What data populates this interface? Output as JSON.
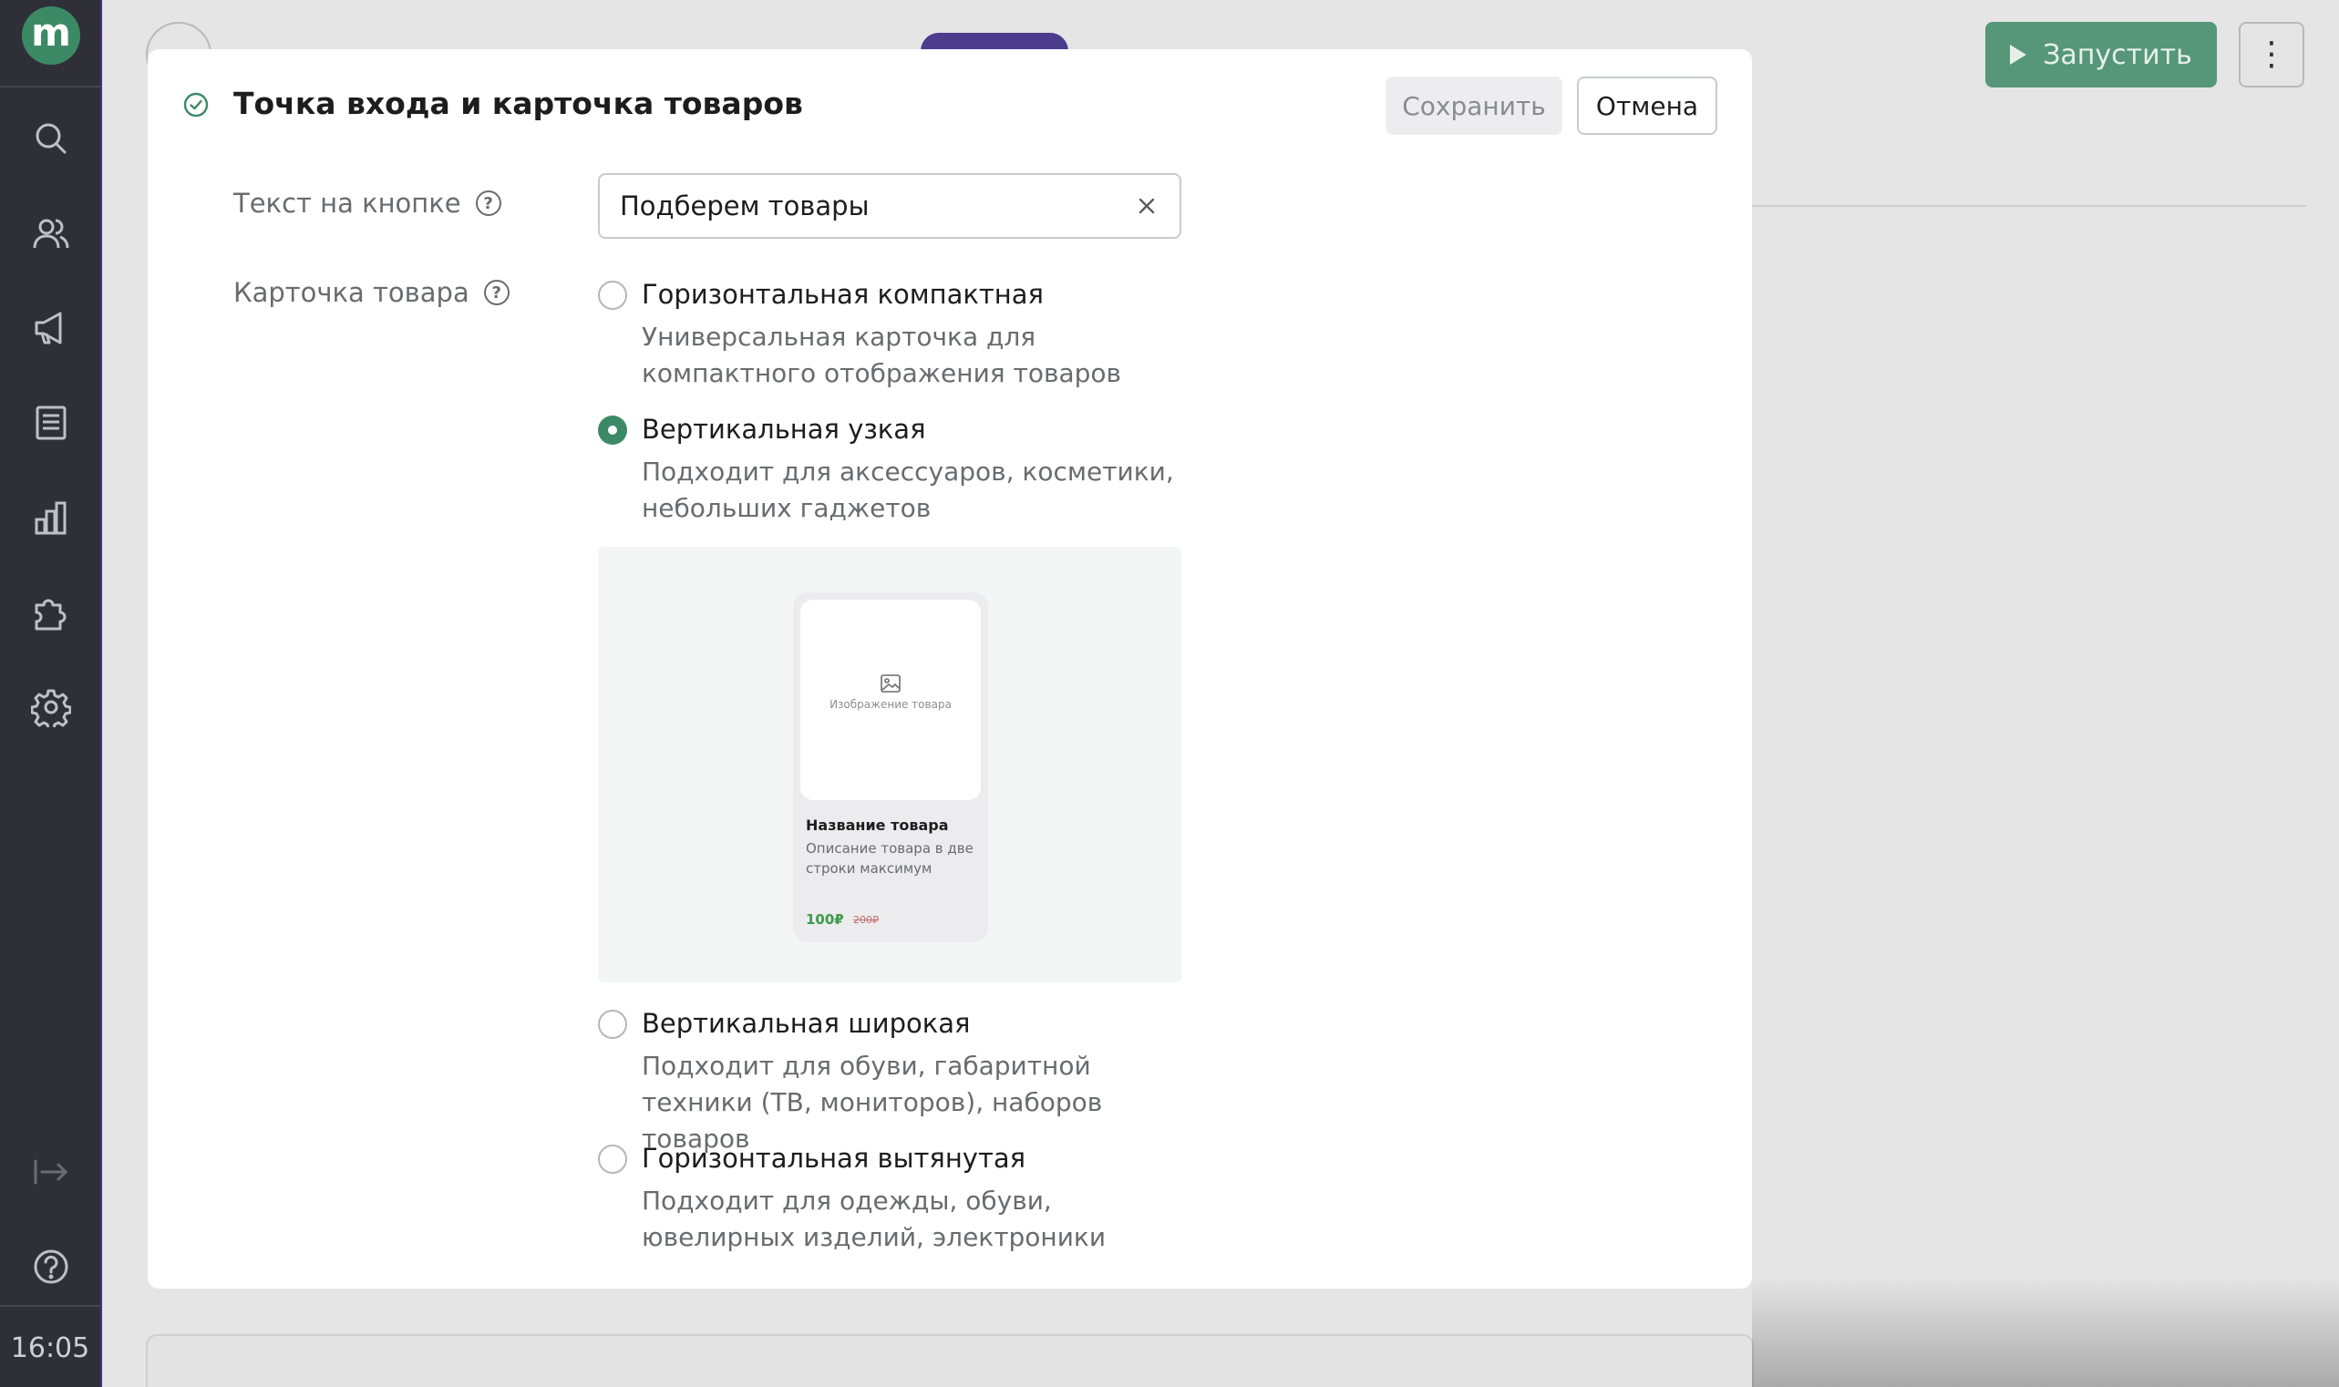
{
  "sidebar": {
    "logo": "m",
    "time": "16:05",
    "items": [
      {
        "icon": "search-icon"
      },
      {
        "icon": "users-icon"
      },
      {
        "icon": "megaphone-icon"
      },
      {
        "icon": "document-icon"
      },
      {
        "icon": "bar-chart-icon"
      },
      {
        "icon": "puzzle-icon"
      },
      {
        "icon": "gear-icon"
      }
    ],
    "bottom_items": [
      {
        "icon": "collapse-icon"
      },
      {
        "icon": "help-icon"
      }
    ]
  },
  "header": {
    "run_label": "Запустить"
  },
  "modal": {
    "title": "Точка входа и карточка товаров",
    "save_label": "Сохранить",
    "cancel_label": "Отмена",
    "button_text": {
      "label": "Текст на кнопке",
      "value": "Подберем товары"
    },
    "card": {
      "label": "Карточка товара",
      "options": [
        {
          "title": "Горизонтальная компактная",
          "description": "Универсальная карточка для компактного отображения товаров",
          "checked": false
        },
        {
          "title": "Вертикальная узкая",
          "description": "Подходит для аксессуаров, косметики, небольших гаджетов",
          "checked": true
        },
        {
          "title": "Вертикальная широкая",
          "description": "Подходит для обуви, габаритной техники (ТВ, мониторов), наборов товаров",
          "checked": false
        },
        {
          "title": "Горизонтальная вытянутая",
          "description": "Подходит для одежды, обуви, ювелирных изделий, электроники",
          "checked": false
        }
      ],
      "preview": {
        "image_label": "Изображение товара",
        "name": "Название товара",
        "description": "Описание товара в две строки максимум",
        "price": "100₽",
        "old_price": "200₽"
      }
    }
  },
  "colors": {
    "accent": "#3c8a65",
    "sidebar_bg": "#2f3037",
    "overlay_bg": "#e5e5e6"
  }
}
